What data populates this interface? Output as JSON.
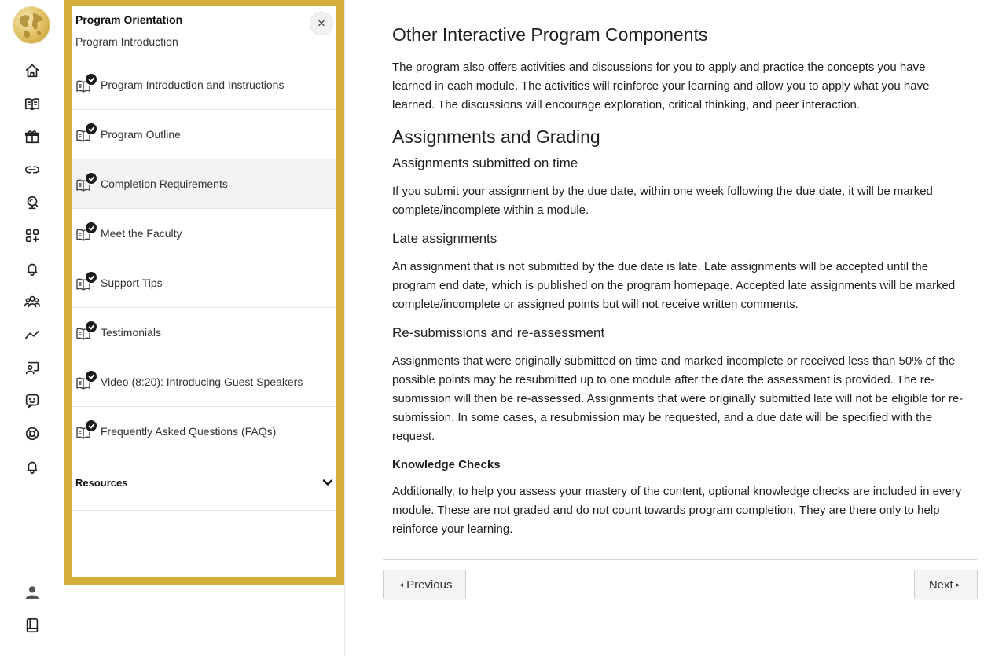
{
  "rail": {
    "logo_icon": "globe-logo",
    "items": [
      {
        "name": "home-icon"
      },
      {
        "name": "book-open-icon"
      },
      {
        "name": "gift-icon"
      },
      {
        "name": "link-icon"
      },
      {
        "name": "monitor-icon"
      },
      {
        "name": "apps-add-icon"
      },
      {
        "name": "bell-icon"
      },
      {
        "name": "people-icon"
      },
      {
        "name": "trend-icon"
      },
      {
        "name": "presenter-icon"
      },
      {
        "name": "chat-emoji-icon"
      },
      {
        "name": "lifebuoy-icon"
      },
      {
        "name": "bell-icon-2"
      }
    ],
    "bottom": [
      {
        "name": "user-icon"
      },
      {
        "name": "notebook-icon"
      }
    ]
  },
  "panel": {
    "title": "Program Orientation",
    "subtitle": "Program Introduction",
    "close_symbol": "×",
    "items": [
      {
        "label": "Program Introduction and Instructions",
        "completed": true,
        "active": false
      },
      {
        "label": "Program Outline",
        "completed": true,
        "active": false
      },
      {
        "label": "Completion Requirements",
        "completed": true,
        "active": true
      },
      {
        "label": "Meet the Faculty",
        "completed": true,
        "active": false
      },
      {
        "label": "Support Tips",
        "completed": true,
        "active": false
      },
      {
        "label": "Testimonials",
        "completed": true,
        "active": false
      },
      {
        "label": "Video (8:20): Introducing Guest Speakers",
        "completed": true,
        "active": false
      },
      {
        "label": "Frequently Asked Questions (FAQs)",
        "completed": true,
        "active": false
      }
    ],
    "resources_label": "Resources",
    "accent_color": "#d4ae3a"
  },
  "main": {
    "h_other": "Other Interactive Program Components",
    "p_other": "The program also offers activities and discussions for you to apply and practice the concepts you have learned in each module. The activities will reinforce your learning and allow you to apply what you have learned. The discussions will encourage exploration, critical thinking, and peer interaction.",
    "h_assign": "Assignments and Grading",
    "h_ontime": "Assignments submitted on time",
    "p_ontime": "If you submit your assignment by the due date, within one week following the due date, it will be marked complete/incomplete within a module.",
    "h_late": "Late assignments",
    "p_late": "An assignment that is not submitted by the due date is late. Late assignments will be accepted until the program end date, which is published on the program homepage. Accepted late assignments will be marked complete/incomplete or assigned points but will not receive written comments.",
    "h_resub": "Re-submissions and re-assessment",
    "p_resub": "Assignments that were originally submitted on time and marked incomplete or received less than 50% of the possible points may be resubmitted up to one module after the date the assessment is provided. The re-submission will then be re-assessed. Assignments that were originally submitted late will not be eligible for re-submission. In some cases, a resubmission may be requested, and a due date will be specified with the request.",
    "h_kc": "Knowledge Checks",
    "p_kc": "Additionally, to help you assess your mastery of the content, optional knowledge checks are included in every module. These are not graded and do not count towards program completion. They are there only to help reinforce your learning.",
    "prev_label": "Previous",
    "next_label": "Next",
    "prev_symbol": "◂",
    "next_symbol": "▸"
  }
}
